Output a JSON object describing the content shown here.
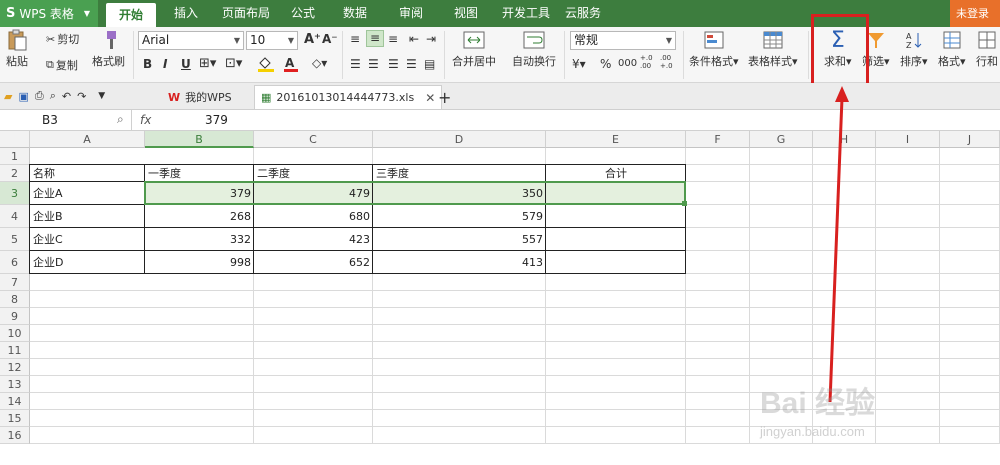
{
  "menubar": {
    "app_label": "WPS 表格",
    "tabs": [
      "开始",
      "插入",
      "页面布局",
      "公式",
      "数据",
      "审阅",
      "视图",
      "开发工具",
      "云服务"
    ],
    "active_tab": "开始",
    "login_label": "未登录"
  },
  "ribbon": {
    "paste": "粘贴",
    "cut": "剪切",
    "copy": "复制",
    "format_painter": "格式刷",
    "font_name": "Arial",
    "font_size": "10",
    "bold": "B",
    "italic": "I",
    "underline": "U",
    "merge_center": "合并居中",
    "wrap_text": "自动换行",
    "number_format": "常规",
    "percent": "%",
    "thousands": "000",
    "inc_decimal": "+.0 .00",
    "dec_decimal": ".00 +.0",
    "cond_format": "条件格式",
    "table_style": "表格样式",
    "sum": "求和",
    "filter": "筛选",
    "sort": "排序",
    "format": "格式",
    "rows_cols": "行和"
  },
  "tabbar": {
    "home_tab": "我的WPS",
    "file_tab": "20161013014444773.xls",
    "add_tab": "+"
  },
  "formulabar": {
    "cell_ref": "B3",
    "fx": "fx",
    "value": "379"
  },
  "columns": [
    "A",
    "B",
    "C",
    "D",
    "E",
    "F",
    "G",
    "H",
    "I",
    "J"
  ],
  "rows": [
    "1",
    "2",
    "3",
    "4",
    "5",
    "6",
    "7",
    "8",
    "9",
    "10",
    "11",
    "12",
    "13",
    "14",
    "15",
    "16"
  ],
  "table": {
    "headers": [
      "名称",
      "一季度",
      "二季度",
      "三季度",
      "合计"
    ],
    "rows": [
      [
        "企业A",
        "379",
        "479",
        "350",
        ""
      ],
      [
        "企业B",
        "268",
        "680",
        "579",
        ""
      ],
      [
        "企业C",
        "332",
        "423",
        "557",
        ""
      ],
      [
        "企业D",
        "998",
        "652",
        "413",
        ""
      ]
    ]
  },
  "watermark": {
    "logo": "Bai 经验",
    "url": "jingyan.baidu.com"
  },
  "colors": {
    "menubar": "#3d7d3e",
    "selection": "#4f9a4d",
    "annotation": "#d8201f"
  }
}
